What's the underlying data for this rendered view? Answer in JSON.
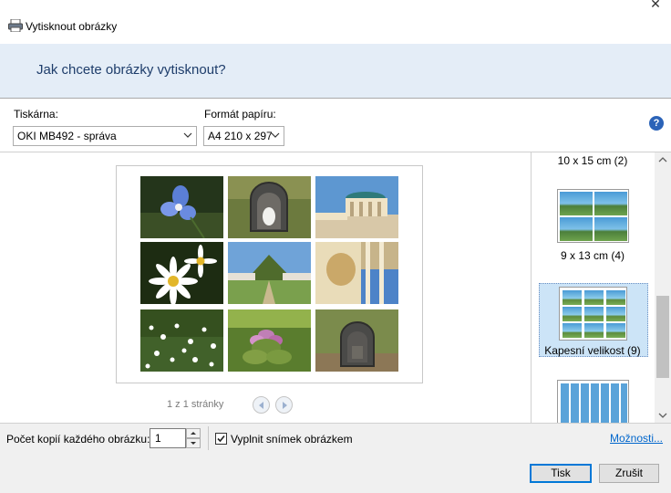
{
  "window": {
    "title": "Vytisknout obrázky",
    "header": "Jak chcete obrázky vytisknout?"
  },
  "printer": {
    "label": "Tiskárna:",
    "value": "OKI MB492 - správa"
  },
  "paper": {
    "label": "Formát papíru:",
    "value": "A4 210 x 297"
  },
  "preview": {
    "page_info": "1 z 1 stránky",
    "thumbnails": [
      "flower-blue",
      "mailbox-grass",
      "building-balcony",
      "daisy",
      "garden-mound",
      "building-pillar",
      "daisies-meadow",
      "pink-flowers",
      "mailbox-ground"
    ]
  },
  "layouts": [
    {
      "label": "10 x 15 cm (2)"
    },
    {
      "label": "9 x 13 cm (4)"
    },
    {
      "label": "Kapesní velikost (9)"
    },
    {
      "label": ""
    }
  ],
  "footer": {
    "copies_label": "Počet kopií každého obrázku:",
    "copies_value": "1",
    "fit_label": "Vyplnit snímek obrázkem",
    "fit_checked": true,
    "options_link": "Možnosti...",
    "print_button": "Tisk",
    "cancel_button": "Zrušit"
  },
  "colors": {
    "accent": "#0078d7",
    "header_band": "#e4edf7",
    "header_text": "#1e3d6b",
    "link": "#0066cc"
  }
}
